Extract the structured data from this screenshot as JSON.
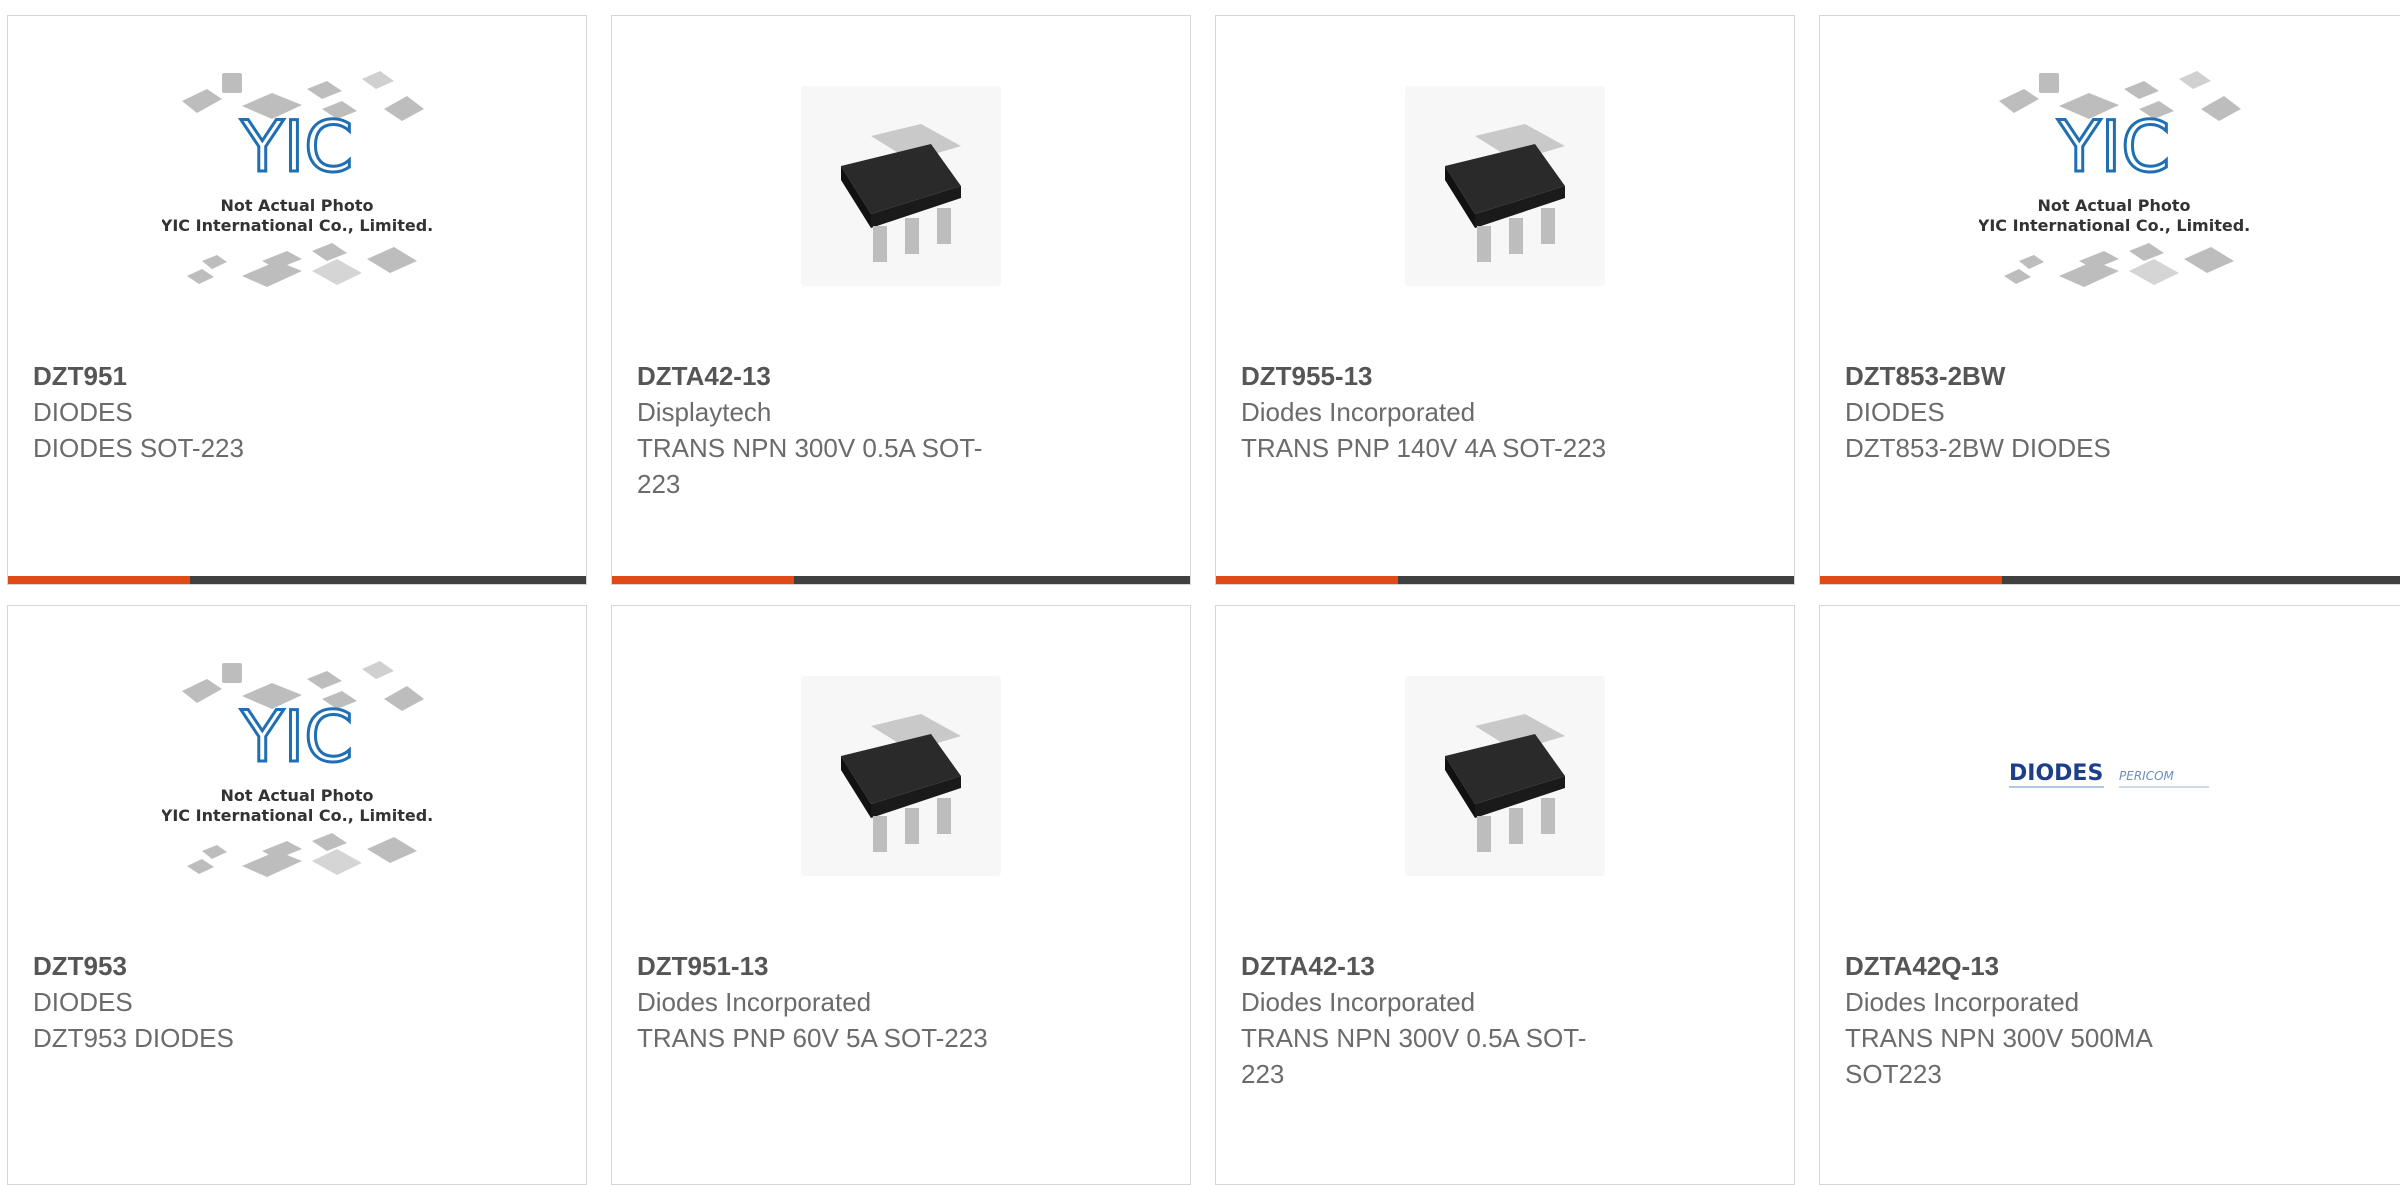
{
  "colors": {
    "accent": "#e04a16",
    "bar": "#404040",
    "border": "#d6d6d6",
    "text": "#6b6b6b",
    "yic_blue": "#1f6fb2"
  },
  "placeholder": {
    "line1": "Not Actual Photo",
    "line2": "YIC International Co., Limited.",
    "logo": "YIC"
  },
  "diodes_logo": {
    "brand": "DIODES",
    "sub": "PERICOM"
  },
  "products": [
    {
      "part": "DZT951",
      "manufacturer": "DIODES",
      "description": "DIODES SOT-223",
      "image": "yic-placeholder"
    },
    {
      "part": "DZTA42-13",
      "manufacturer": "Displaytech",
      "description": "TRANS NPN 300V 0.5A SOT-223",
      "image": "sot223-photo"
    },
    {
      "part": "DZT955-13",
      "manufacturer": "Diodes Incorporated",
      "description": "TRANS PNP 140V 4A SOT-223",
      "image": "sot223-photo"
    },
    {
      "part": "DZT853-2BW",
      "manufacturer": "DIODES",
      "description": "DZT853-2BW DIODES",
      "image": "yic-placeholder"
    },
    {
      "part": "DZT953",
      "manufacturer": "DIODES",
      "description": "DZT953 DIODES",
      "image": "yic-placeholder"
    },
    {
      "part": "DZT951-13",
      "manufacturer": "Diodes Incorporated",
      "description": "TRANS PNP 60V 5A SOT-223",
      "image": "sot223-photo"
    },
    {
      "part": "DZTA42-13",
      "manufacturer": "Diodes Incorporated",
      "description": "TRANS NPN 300V 0.5A SOT-223",
      "image": "sot223-photo"
    },
    {
      "part": "DZTA42Q-13",
      "manufacturer": "Diodes Incorporated",
      "description": "TRANS NPN 300V 500MA SOT223",
      "image": "diodes-logo"
    }
  ]
}
